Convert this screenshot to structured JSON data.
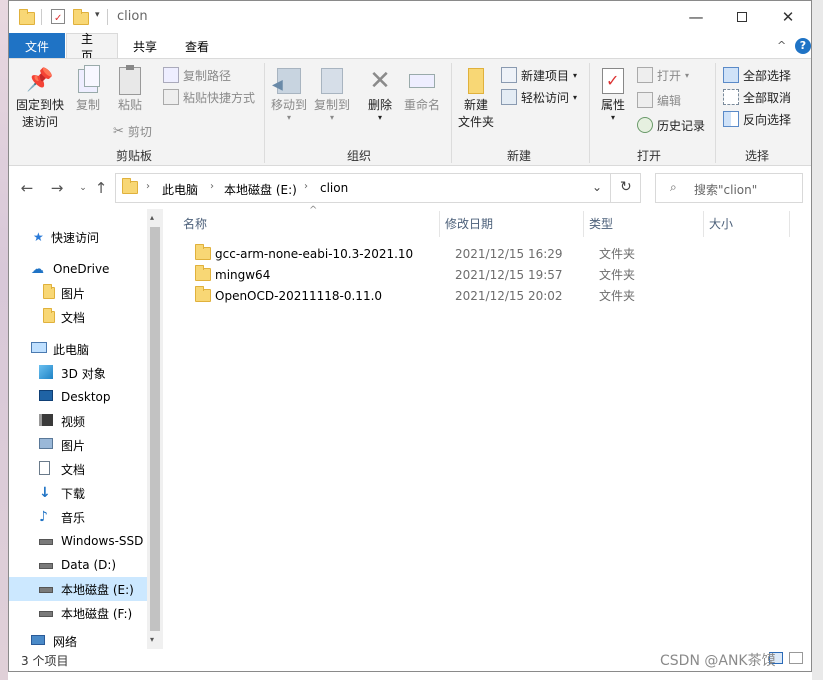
{
  "title": {
    "path": "clion"
  },
  "tabs": {
    "file": "文件",
    "home": "主页",
    "share": "共享",
    "view": "查看"
  },
  "ribbon": {
    "clipboard": {
      "label": "剪贴板",
      "pin_line1": "固定到快",
      "pin_line2": "速访问",
      "copy": "复制",
      "paste": "粘贴",
      "copy_path": "复制路径",
      "paste_shortcut": "粘贴快捷方式",
      "cut": "剪切"
    },
    "organize": {
      "label": "组织",
      "move_to": "移动到",
      "copy_to": "复制到",
      "delete": "删除",
      "rename": "重命名"
    },
    "new": {
      "label": "新建",
      "new_folder_line1": "新建",
      "new_folder_line2": "文件夹",
      "new_item": "新建项目",
      "easy_access": "轻松访问"
    },
    "open": {
      "label": "打开",
      "properties": "属性",
      "open": "打开",
      "edit": "编辑",
      "history": "历史记录"
    },
    "select": {
      "label": "选择",
      "select_all": "全部选择",
      "select_none": "全部取消",
      "invert": "反向选择"
    }
  },
  "address": {
    "crumbs": [
      "此电脑",
      "本地磁盘 (E:)",
      "clion"
    ]
  },
  "search": {
    "placeholder": "搜索\"clion\""
  },
  "sidebar": {
    "items": [
      {
        "label": "快速访问",
        "icon": "star-icon"
      },
      {
        "label": "OneDrive",
        "icon": "cloud-icon"
      },
      {
        "label": "图片",
        "icon": "folder-icon"
      },
      {
        "label": "文档",
        "icon": "folder-icon"
      },
      {
        "label": "此电脑",
        "icon": "computer-icon"
      },
      {
        "label": "3D 对象",
        "icon": "cube-icon"
      },
      {
        "label": "Desktop",
        "icon": "desktop-icon"
      },
      {
        "label": "视频",
        "icon": "video-icon"
      },
      {
        "label": "图片",
        "icon": "pictures-icon"
      },
      {
        "label": "文档",
        "icon": "document-icon"
      },
      {
        "label": "下载",
        "icon": "download-icon"
      },
      {
        "label": "音乐",
        "icon": "music-icon"
      },
      {
        "label": "Windows-SSD",
        "icon": "drive-icon"
      },
      {
        "label": "Data (D:)",
        "icon": "drive-icon"
      },
      {
        "label": "本地磁盘 (E:)",
        "icon": "drive-icon"
      },
      {
        "label": "本地磁盘 (F:)",
        "icon": "drive-icon"
      },
      {
        "label": "网络",
        "icon": "network-icon"
      }
    ]
  },
  "columns": {
    "name": "名称",
    "date": "修改日期",
    "type": "类型",
    "size": "大小"
  },
  "files": [
    {
      "name": "gcc-arm-none-eabi-10.3-2021.10",
      "date": "2021/12/15 16:29",
      "type": "文件夹",
      "size": ""
    },
    {
      "name": "mingw64",
      "date": "2021/12/15 19:57",
      "type": "文件夹",
      "size": ""
    },
    {
      "name": "OpenOCD-20211118-0.11.0",
      "date": "2021/12/15 20:02",
      "type": "文件夹",
      "size": ""
    }
  ],
  "status": {
    "count": "3 个项目"
  },
  "watermark": "CSDN @ANK茶馍",
  "colors": {
    "accent": "#1f73c5",
    "selection": "#cce8ff",
    "folder": "#f8d775"
  }
}
